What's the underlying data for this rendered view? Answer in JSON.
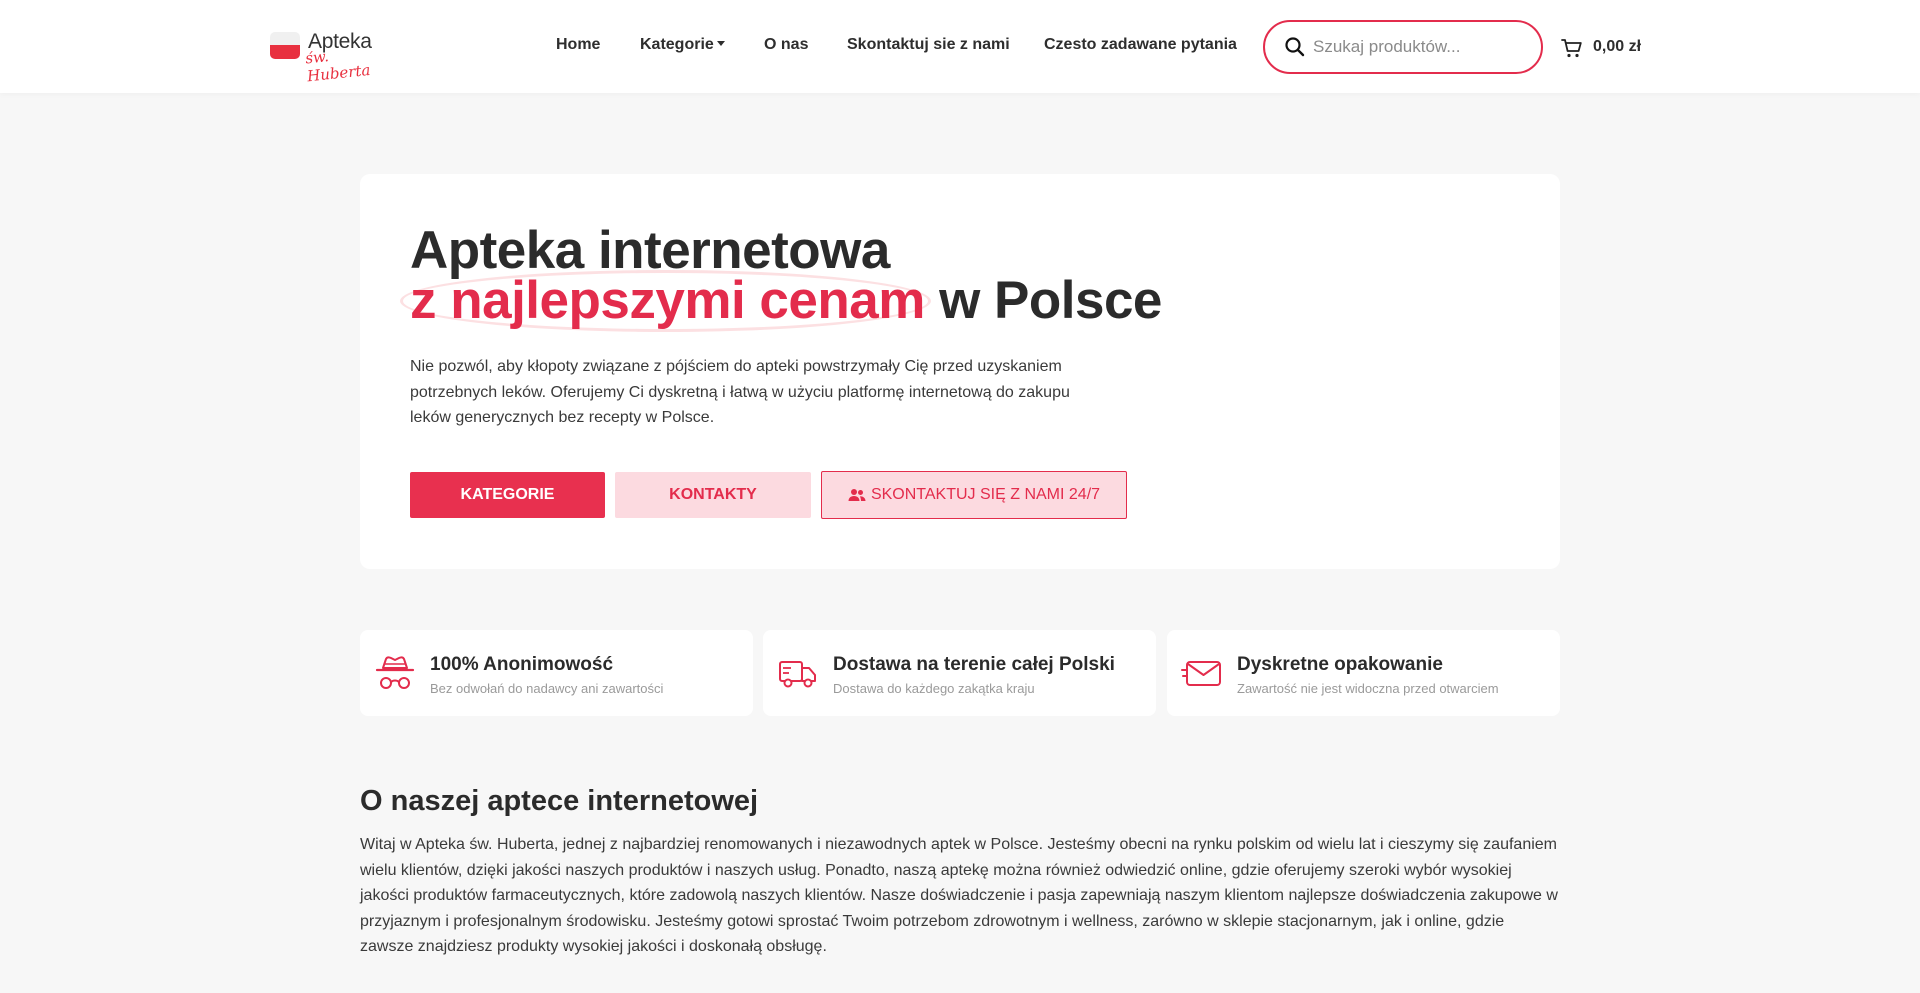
{
  "brand": {
    "name": "Apteka",
    "script": "św. Huberta",
    "accent_color": "#e32c4c"
  },
  "nav": {
    "items": [
      {
        "label": "Home"
      },
      {
        "label": "Kategorie"
      },
      {
        "label": "O nas"
      },
      {
        "label": "Skontaktuj sie z nami"
      },
      {
        "label": "Czesto zadawane pytania"
      }
    ]
  },
  "search": {
    "placeholder": "Szukaj produktów...",
    "icon": "search-icon"
  },
  "cart": {
    "total": "0,00 zł",
    "icon": "cart-icon"
  },
  "hero": {
    "title_line1": "Apteka internetowa",
    "title_accent": "z najlepszymi cenam",
    "title_rest": " w Polsce",
    "description": "Nie pozwól, aby kłopoty związane z pójściem do apteki powstrzymały Cię przed uzyskaniem potrzebnych leków. Oferujemy Ci dyskretną i łatwą w użyciu platformę internetową do zakupu leków generycznych bez recepty w Polsce.",
    "buttons": {
      "categories": "KATEGORIE",
      "contacts": "KONTAKTY",
      "contact_us": "SKONTAKTUJ SIĘ Z NAMI 24/7"
    }
  },
  "features": [
    {
      "title": "100% Anonimowość",
      "subtitle": "Bez odwołań do nadawcy ani zawartości",
      "icon": "incognito-icon"
    },
    {
      "title": "Dostawa na terenie całej Polski",
      "subtitle": "Dostawa do każdego zakątka kraju",
      "icon": "truck-icon"
    },
    {
      "title": "Dyskretne opakowanie",
      "subtitle": "Zawartość nie jest widoczna przed otwarciem",
      "icon": "envelope-icon"
    }
  ],
  "about": {
    "title": "O naszej aptece internetowej",
    "text": "Witaj w Apteka św. Huberta, jednej z najbardziej renomowanych i niezawodnych aptek w Polsce. Jesteśmy obecni na rynku polskim od wielu lat i cieszymy się zaufaniem wielu klientów, dzięki jakości naszych produktów i naszych usług. Ponadto, naszą aptekę można również odwiedzić online, gdzie oferujemy szeroki wybór wysokiej jakości produktów farmaceutycznych, które zadowolą naszych klientów. Nasze doświadczenie i pasja zapewniają naszym klientom najlepsze doświadczenia zakupowe w przyjaznym i profesjonalnym środowisku. Jesteśmy gotowi sprostać Twoim potrzebom zdrowotnym i wellness, zarówno w sklepie stacjonarnym, jak i online, gdzie zawsze znajdziesz produkty wysokiej jakości i doskonałą obsługę."
  }
}
